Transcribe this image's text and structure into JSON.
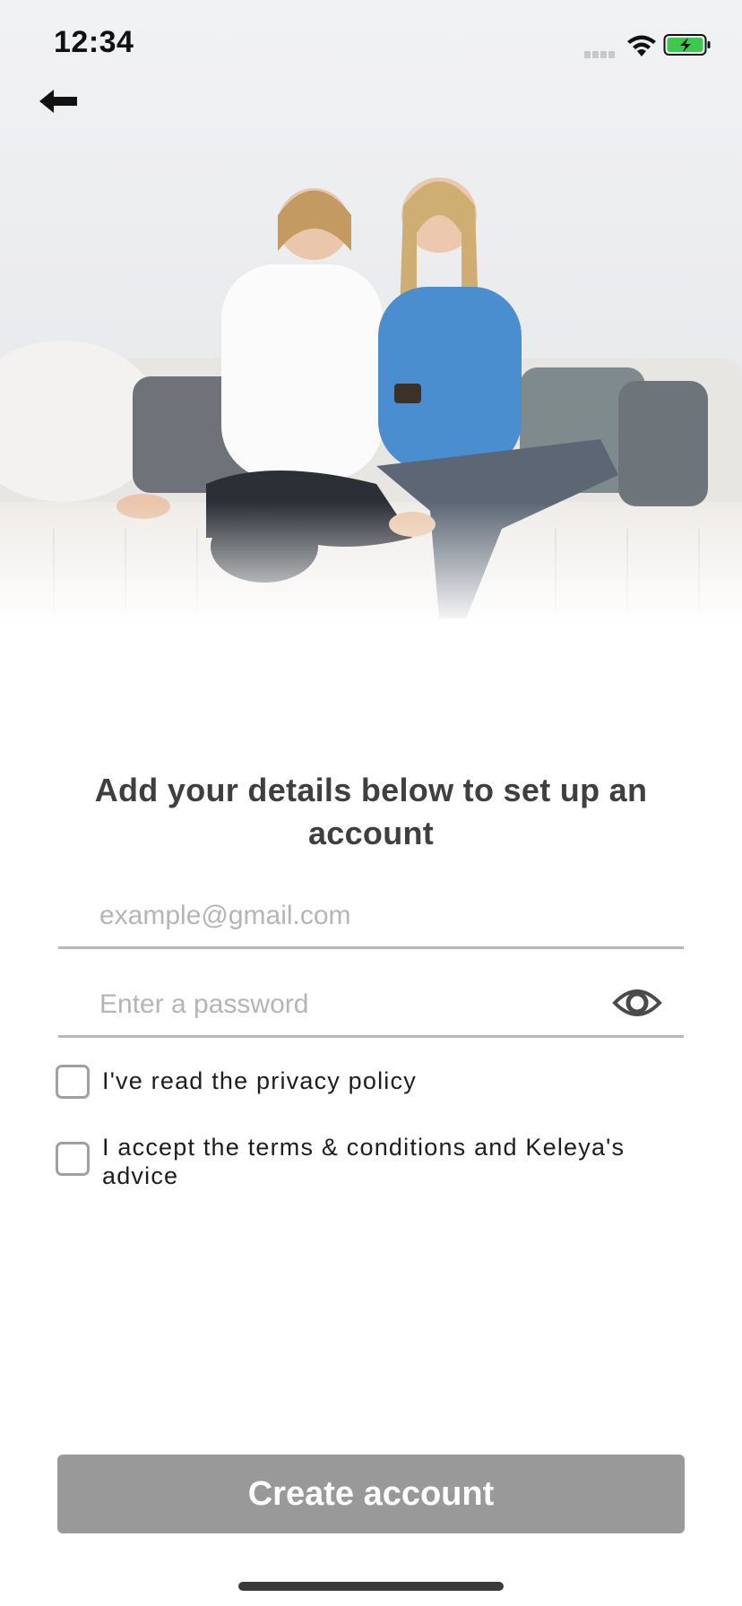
{
  "status_bar": {
    "time": "12:34"
  },
  "hero": {
    "image_description": ""
  },
  "form": {
    "heading": "Add your details below to set up an account",
    "email_placeholder": "example@gmail.com",
    "password_placeholder": "Enter a password",
    "privacy_label": "I've read the privacy policy",
    "terms_label": "I accept the terms & conditions and Keleya's advice",
    "submit_label": "Create account"
  },
  "colors": {
    "button_disabled": "#999999",
    "battery_green": "#3cc94e",
    "underline": "#b8b8b8"
  },
  "icons": [
    "back-arrow-icon",
    "wifi-icon",
    "battery-charging-icon",
    "eye-icon"
  ]
}
